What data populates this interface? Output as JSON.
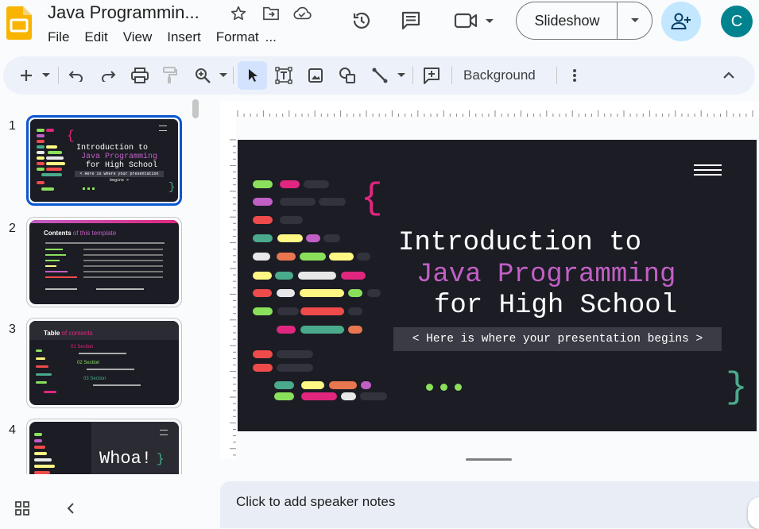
{
  "header": {
    "doc_title": "Java Programmin...",
    "menu": [
      "File",
      "Edit",
      "View",
      "Insert",
      "Format",
      "..."
    ],
    "slideshow_label": "Slideshow",
    "avatar_letter": "C"
  },
  "toolbar": {
    "background_label": "Background"
  },
  "filmstrip": {
    "slides": [
      {
        "number": "1"
      },
      {
        "number": "2",
        "title_a": "Contents",
        "title_b": "of this template"
      },
      {
        "number": "3",
        "title_a": "Table",
        "title_b": "of contents",
        "sections": [
          {
            "num": "01",
            "label": "Section"
          },
          {
            "num": "02",
            "label": "Section"
          },
          {
            "num": "03",
            "label": "Section"
          }
        ]
      },
      {
        "number": "4",
        "text": "Whoa!"
      }
    ]
  },
  "slide": {
    "title_line1": "Introduction to",
    "title_line2": "Java Programming",
    "title_line3": "for High School",
    "subtitle": "< Here is where your presentation begins >",
    "brace_open": "{",
    "brace_close": "}",
    "colors": {
      "bg": "#1b1c24",
      "pink": "#e0267f",
      "purple": "#c15fc4",
      "green": "#8be05b",
      "teal": "#4aaa8c",
      "yellow": "#fff783",
      "red": "#ef4b4b",
      "orange": "#e8764f"
    }
  },
  "notes": {
    "placeholder": "Click to add speaker notes"
  }
}
